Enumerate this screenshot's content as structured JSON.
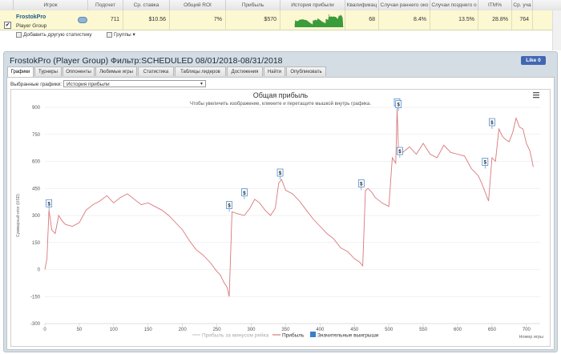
{
  "grid": {
    "columns": [
      {
        "key": "player",
        "label": "Игрок"
      },
      {
        "key": "count",
        "label": "Подсчет"
      },
      {
        "key": "avg_stake",
        "label": "Ср. ставка"
      },
      {
        "key": "roi",
        "label": "Общий ROI"
      },
      {
        "key": "profit",
        "label": "Прибыль"
      },
      {
        "key": "history",
        "label": "История прибыли"
      },
      {
        "key": "qual",
        "label": "Квалификац"
      },
      {
        "key": "early",
        "label": "Случаи раннего око"
      },
      {
        "key": "late",
        "label": "Случаи позднего о"
      },
      {
        "key": "itm",
        "label": "ITM%"
      },
      {
        "key": "avg_place",
        "label": "Ср. уча"
      }
    ],
    "row": {
      "player_name": "FrostokPro",
      "player_group": "Player Group",
      "count": "711",
      "avg_stake": "$10.56",
      "roi": "7%",
      "profit": "$570",
      "qual": "68",
      "early": "8.4%",
      "late": "13.5%",
      "itm": "28.8%",
      "avg_place": "764"
    },
    "toolbar": {
      "add_stats": "Добавить другую статистику",
      "groups": "Группы"
    }
  },
  "panel": {
    "title": "FrostokPro (Player Group) Фильтр:SCHEDULED 08/01/2018-08/31/2018",
    "like_label": "Like 0",
    "tabs": [
      "Графики",
      "Турниры",
      "Оппоненты",
      "Любимые игры",
      "Статистика",
      "Таблицы лидеров",
      "Достижения",
      "Найти",
      "Опубликовать"
    ],
    "active_tab": 0,
    "chart_select_label": "Выбранные графики:",
    "chart_select_value": "История прибыли"
  },
  "chart_data": {
    "type": "line",
    "title": "Общая прибыль",
    "subtitle": "Чтобы увеличить изображение, кликните и перетащите мышкой внутрь графика.",
    "ylabel": "Суммарный итог (USD)",
    "xlabel": "Номер игры",
    "ylim": [
      -300,
      900
    ],
    "xlim": [
      0,
      720
    ],
    "yticks": [
      -300,
      -150,
      0,
      150,
      300,
      450,
      600,
      750,
      900
    ],
    "xticks": [
      0,
      50,
      100,
      150,
      200,
      250,
      300,
      350,
      400,
      450,
      500,
      550,
      600,
      650,
      700
    ],
    "grid": "horizontal",
    "legend_position": "bottom",
    "series": [
      {
        "name": "Прибыль",
        "color": "#d9787a",
        "x": [
          0,
          3,
          6,
          10,
          15,
          20,
          25,
          30,
          40,
          50,
          60,
          70,
          80,
          90,
          100,
          110,
          120,
          130,
          140,
          150,
          160,
          170,
          180,
          190,
          200,
          210,
          220,
          230,
          240,
          250,
          255,
          260,
          265,
          268,
          272,
          280,
          290,
          298,
          305,
          312,
          320,
          328,
          335,
          340,
          344,
          350,
          360,
          370,
          380,
          390,
          400,
          410,
          420,
          430,
          440,
          450,
          458,
          462,
          466,
          470,
          475,
          480,
          490,
          500,
          505,
          510,
          512,
          514,
          516,
          520,
          530,
          540,
          550,
          560,
          570,
          580,
          590,
          600,
          610,
          620,
          630,
          635,
          640,
          645,
          650,
          655,
          660,
          665,
          670,
          675,
          680,
          685,
          690,
          695,
          700,
          705,
          710
        ],
        "y": [
          0,
          60,
          330,
          220,
          200,
          300,
          270,
          250,
          240,
          260,
          330,
          360,
          380,
          410,
          370,
          400,
          420,
          390,
          360,
          370,
          350,
          330,
          300,
          260,
          220,
          160,
          110,
          80,
          40,
          -10,
          -30,
          -70,
          -100,
          -150,
          320,
          310,
          300,
          340,
          390,
          370,
          330,
          300,
          340,
          480,
          500,
          440,
          420,
          380,
          330,
          280,
          240,
          200,
          170,
          120,
          100,
          60,
          40,
          20,
          440,
          450,
          430,
          400,
          370,
          350,
          620,
          590,
          890,
          660,
          640,
          650,
          680,
          640,
          700,
          640,
          620,
          690,
          650,
          640,
          630,
          560,
          520,
          480,
          430,
          380,
          620,
          600,
          780,
          740,
          720,
          710,
          760,
          840,
          790,
          780,
          700,
          660,
          570
        ]
      },
      {
        "name": "Прибыль за минусом рейка",
        "color": "#cccccc",
        "x": [],
        "y": []
      },
      {
        "name": "Значительные выигрыши",
        "color": "#3a7fc8",
        "marker_symbol": "$",
        "x": [
          6,
          268,
          290,
          342,
          460,
          512,
          514,
          516,
          640,
          650
        ],
        "y": [
          330,
          320,
          390,
          500,
          440,
          890,
          880,
          620,
          560,
          780
        ]
      }
    ]
  },
  "colors": {
    "grid_row": "#fbf8d2",
    "panel_bg": "#d4dde4",
    "link": "#1e5a8c",
    "sparkline": "#3a9c3a"
  }
}
